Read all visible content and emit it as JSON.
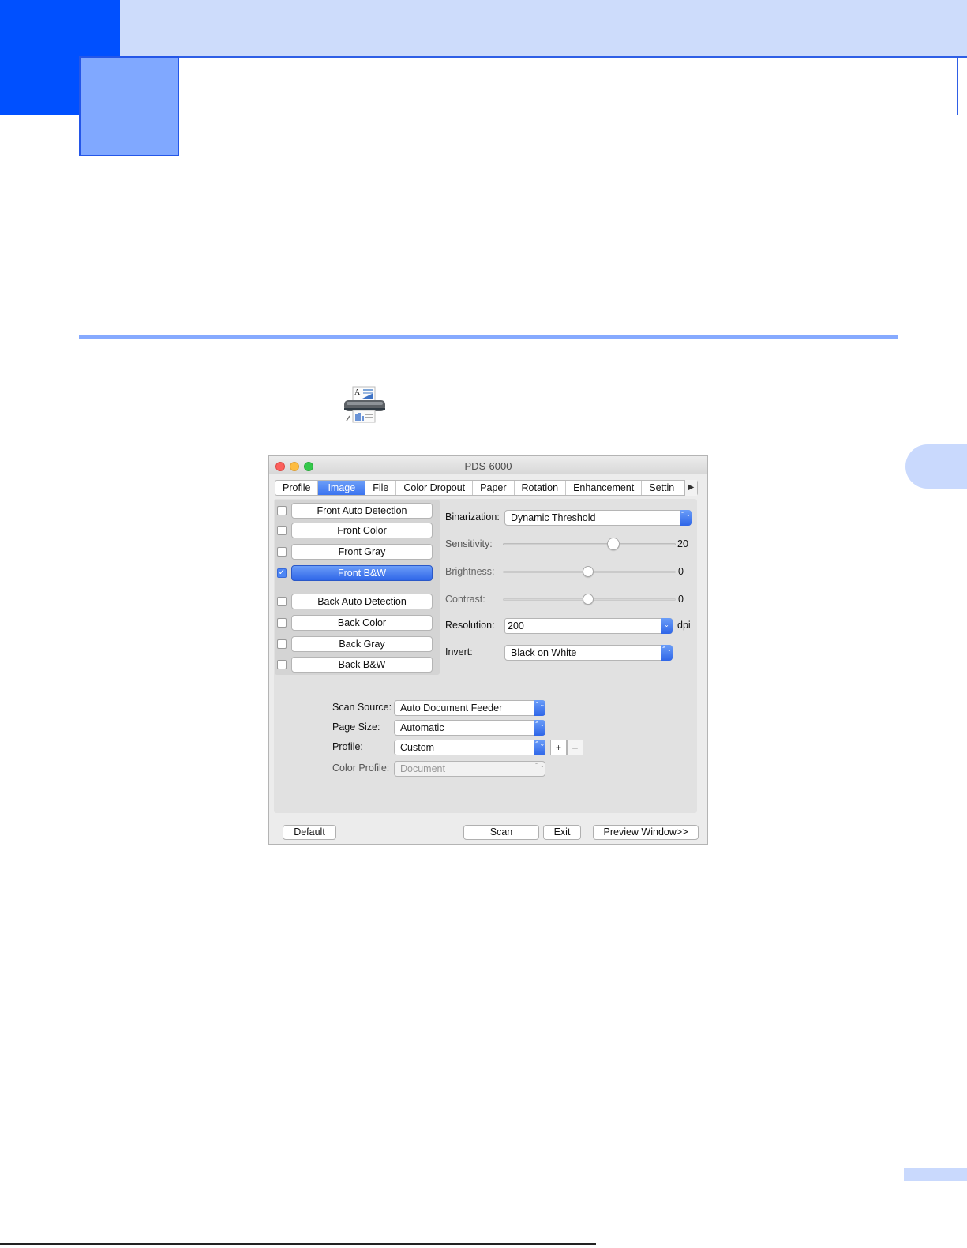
{
  "dialog": {
    "title": "PDS-6000",
    "tabs": [
      "Profile",
      "Image",
      "File",
      "Color Dropout",
      "Paper",
      "Rotation",
      "Enhancement",
      "Settin"
    ],
    "active_tab": "Image",
    "tab_more_glyph": "▶",
    "modes": [
      {
        "label": "Front Auto Detection",
        "checked": false
      },
      {
        "label": "Front Color",
        "checked": false
      },
      {
        "label": "Front Gray",
        "checked": false
      },
      {
        "label": "Front B&W",
        "checked": true
      },
      {
        "label": "Back Auto Detection",
        "checked": false
      },
      {
        "label": "Back Color",
        "checked": false
      },
      {
        "label": "Back Gray",
        "checked": false
      },
      {
        "label": "Back B&W",
        "checked": false
      }
    ],
    "settings": {
      "binarization_label": "Binarization:",
      "binarization_value": "Dynamic Threshold",
      "sensitivity_label": "Sensitivity:",
      "sensitivity_value": "20",
      "brightness_label": "Brightness:",
      "brightness_value": "0",
      "contrast_label": "Contrast:",
      "contrast_value": "0",
      "resolution_label": "Resolution:",
      "resolution_value": "200",
      "resolution_unit": "dpi",
      "invert_label": "Invert:",
      "invert_value": "Black on White"
    },
    "source": {
      "scan_source_label": "Scan Source:",
      "scan_source_value": "Auto Document Feeder",
      "page_size_label": "Page Size:",
      "page_size_value": "Automatic",
      "profile_label": "Profile:",
      "profile_value": "Custom",
      "profile_add": "+",
      "profile_remove": "–",
      "color_profile_label": "Color Profile:",
      "color_profile_value": "Document"
    },
    "buttons": {
      "default": "Default",
      "scan": "Scan",
      "exit": "Exit",
      "preview": "Preview Window>>"
    }
  },
  "icons": {
    "scanner": "scanner-icon",
    "check": "✓",
    "stepper": "⌃⌄",
    "combo_arrow": "⌄"
  },
  "colors": {
    "accent_blue": "#0050ff",
    "light_blue": "#cddcfb",
    "selected_blue": "#3b74f0"
  }
}
